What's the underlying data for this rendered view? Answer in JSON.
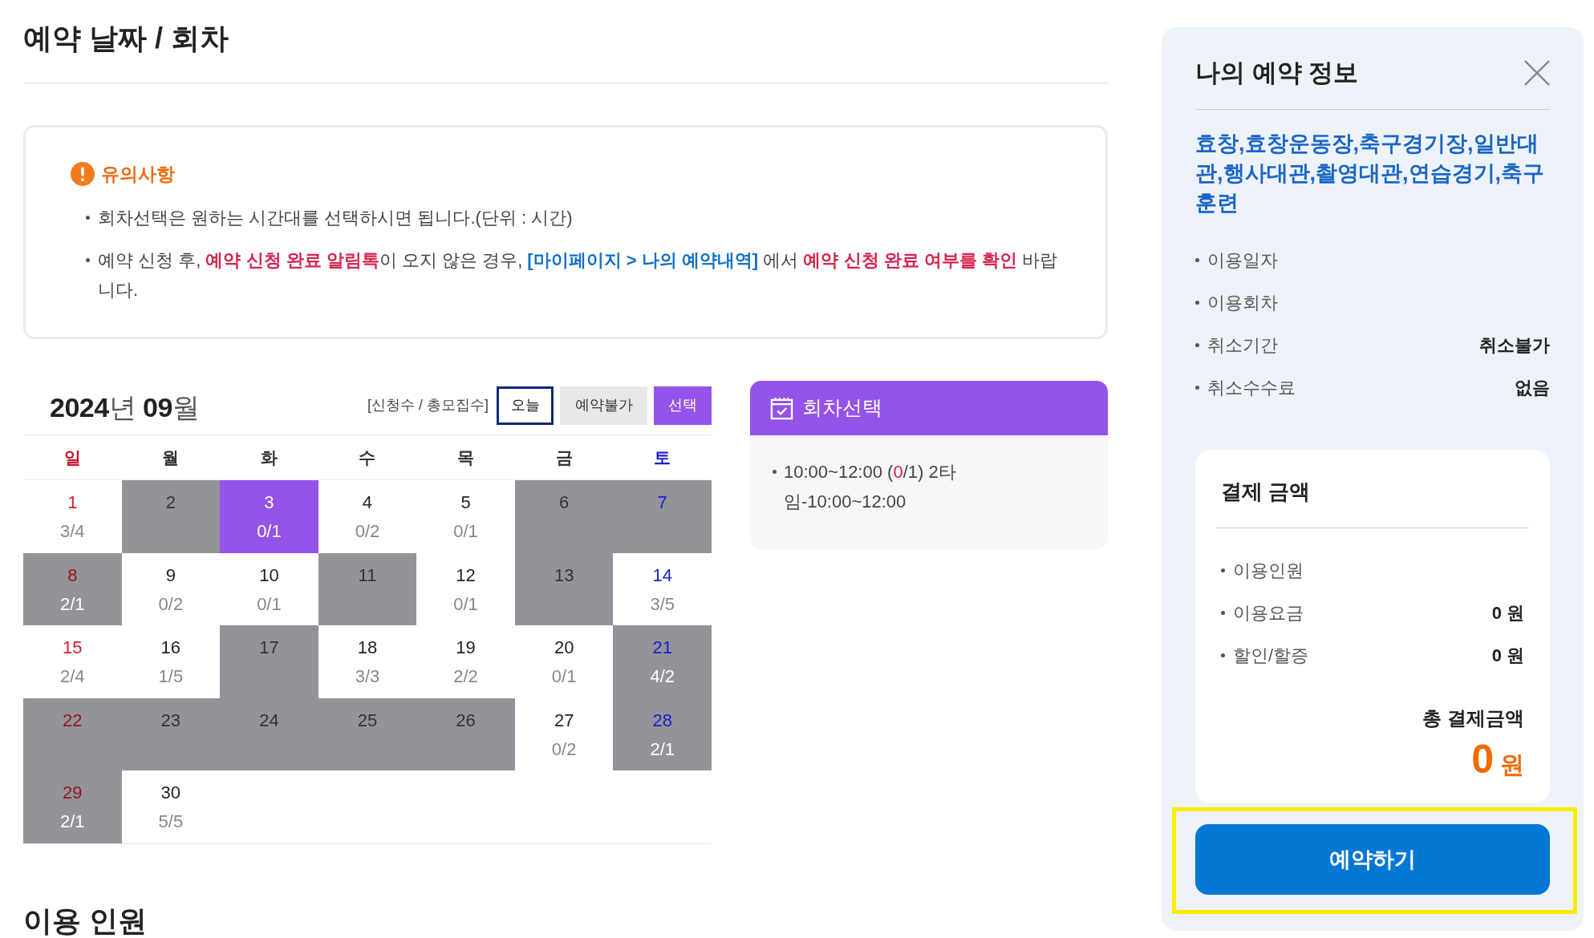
{
  "page_title": "예약 날짜 / 회차",
  "notice": {
    "title": "유의사항",
    "items": [
      {
        "segments": [
          {
            "text": "회차선택은 원하는 시간대를 선택하시면 됩니다.(단위 : 시간)",
            "kind": "plain"
          }
        ]
      },
      {
        "segments": [
          {
            "text": "예약 신청 후, ",
            "kind": "plain"
          },
          {
            "text": "예약 신청 완료 알림톡",
            "kind": "alert"
          },
          {
            "text": "이 오지 않은 경우, ",
            "kind": "plain"
          },
          {
            "text": "[마이페이지 > 나의 예약내역]",
            "kind": "link"
          },
          {
            "text": " 에서 ",
            "kind": "plain"
          },
          {
            "text": "예약 신청 완료 여부를 확인",
            "kind": "alert"
          },
          {
            "text": " 바랍니다.",
            "kind": "plain"
          }
        ]
      }
    ]
  },
  "calendar": {
    "title": "**2024**년 **09**월",
    "legend_label": "[신청수 / 총모집수]",
    "legend": [
      {
        "label": "오늘",
        "kind": "today"
      },
      {
        "label": "예약불가",
        "kind": "unavailable"
      },
      {
        "label": "선택",
        "kind": "selected"
      }
    ],
    "weekdays": [
      {
        "label": "일",
        "kind": "sunday"
      },
      {
        "label": "월",
        "kind": "weekday"
      },
      {
        "label": "화",
        "kind": "weekday"
      },
      {
        "label": "수",
        "kind": "weekday"
      },
      {
        "label": "목",
        "kind": "weekday"
      },
      {
        "label": "금",
        "kind": "weekday"
      },
      {
        "label": "토",
        "kind": "saturday"
      }
    ],
    "days": [
      {
        "day": "1",
        "count": "3/4",
        "selected": false,
        "disabled": false
      },
      {
        "day": "2",
        "selected": false,
        "disabled": true
      },
      {
        "day": "3",
        "count": "0/1",
        "selected": true,
        "disabled": false
      },
      {
        "day": "4",
        "count": "0/2",
        "selected": false,
        "disabled": false
      },
      {
        "day": "5",
        "count": "0/1",
        "selected": false,
        "disabled": false
      },
      {
        "day": "6",
        "selected": false,
        "disabled": true
      },
      {
        "day": "7",
        "selected": false,
        "disabled": true
      },
      {
        "day": "8",
        "count": "2/1",
        "selected": false,
        "disabled": true
      },
      {
        "day": "9",
        "count": "0/2",
        "selected": false,
        "disabled": false
      },
      {
        "day": "10",
        "count": "0/1",
        "selected": false,
        "disabled": false
      },
      {
        "day": "11",
        "selected": false,
        "disabled": true
      },
      {
        "day": "12",
        "count": "0/1",
        "selected": false,
        "disabled": false
      },
      {
        "day": "13",
        "selected": false,
        "disabled": true
      },
      {
        "day": "14",
        "count": "3/5",
        "selected": false,
        "disabled": false
      },
      {
        "day": "15",
        "count": "2/4",
        "selected": false,
        "disabled": false
      },
      {
        "day": "16",
        "count": "1/5",
        "selected": false,
        "disabled": false
      },
      {
        "day": "17",
        "selected": false,
        "disabled": true
      },
      {
        "day": "18",
        "count": "3/3",
        "selected": false,
        "disabled": false
      },
      {
        "day": "19",
        "count": "2/2",
        "selected": false,
        "disabled": false
      },
      {
        "day": "20",
        "count": "0/1",
        "selected": false,
        "disabled": false
      },
      {
        "day": "21",
        "count": "4/2",
        "selected": false,
        "disabled": true
      },
      {
        "day": "22",
        "selected": false,
        "disabled": true
      },
      {
        "day": "23",
        "selected": false,
        "disabled": true
      },
      {
        "day": "24",
        "selected": false,
        "disabled": true
      },
      {
        "day": "25",
        "selected": false,
        "disabled": true
      },
      {
        "day": "26",
        "selected": false,
        "disabled": true
      },
      {
        "day": "27",
        "count": "0/2",
        "selected": false,
        "disabled": false
      },
      {
        "day": "28",
        "count": "2/1",
        "selected": false,
        "disabled": true
      },
      {
        "day": "29",
        "count": "2/1",
        "selected": false,
        "disabled": true
      },
      {
        "day": "30",
        "count": "5/5",
        "selected": false,
        "disabled": false
      }
    ]
  },
  "session": {
    "title": "회차선택",
    "items": [
      {
        "text_before": "10:00~12:00 (",
        "applied": "0",
        "text_after": "/1) 2타임-10:00~12:00",
        "selected": false
      }
    ]
  },
  "next_section_title": "이용 인원",
  "summary": {
    "title": "나의 예약 정보",
    "facility": "효창,효창운동장,축구경기장,일반대관,행사대관,촬영대관,연습경기,축구훈련",
    "details": [
      {
        "label": "이용일자"
      },
      {
        "label": "이용회차"
      },
      {
        "label": "취소기간",
        "value": "취소불가"
      },
      {
        "label": "취소수수료",
        "value": "없음"
      }
    ],
    "payment": {
      "title": "결제 금액",
      "rows": [
        {
          "label": "이용인원"
        },
        {
          "label": "이용요금",
          "value": "0 원"
        },
        {
          "label": "할인/할증",
          "value": "0 원"
        }
      ],
      "total_label": "총 결제금액",
      "total_amount": "0",
      "total_unit": "원"
    },
    "button": {
      "label": "예약하기",
      "highlighted": true
    }
  }
}
